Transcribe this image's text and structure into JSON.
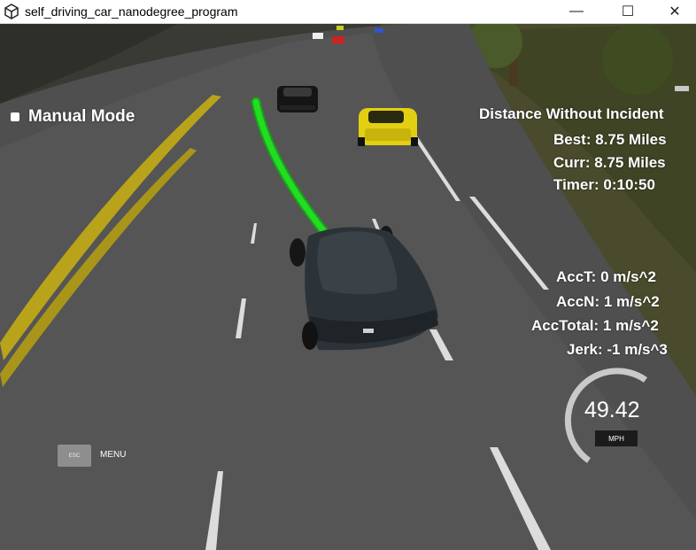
{
  "window": {
    "title": "self_driving_car_nanodegree_program",
    "minimize_glyph": "—",
    "maximize_glyph": "☐",
    "close_glyph": "✕"
  },
  "hud": {
    "mode_label": "Manual Mode",
    "distance_title": "Distance Without Incident",
    "best": "Best: 8.75 Miles",
    "curr": "Curr: 8.75 Miles",
    "timer": "Timer: 0:10:50",
    "acc_t": "AccT: 0 m/s^2",
    "acc_n": "AccN: 1 m/s^2",
    "acc_total": "AccTotal: 1 m/s^2",
    "jerk": "Jerk: -1 m/s^3"
  },
  "speedometer": {
    "value": "49.42",
    "unit": "MPH"
  },
  "menu": {
    "esc_label": "ESC",
    "menu_label": "MENU"
  },
  "colors": {
    "path_green": "#22dd22",
    "lane_yellow": "#b9a31a",
    "car_yellow": "#e3cf12"
  }
}
